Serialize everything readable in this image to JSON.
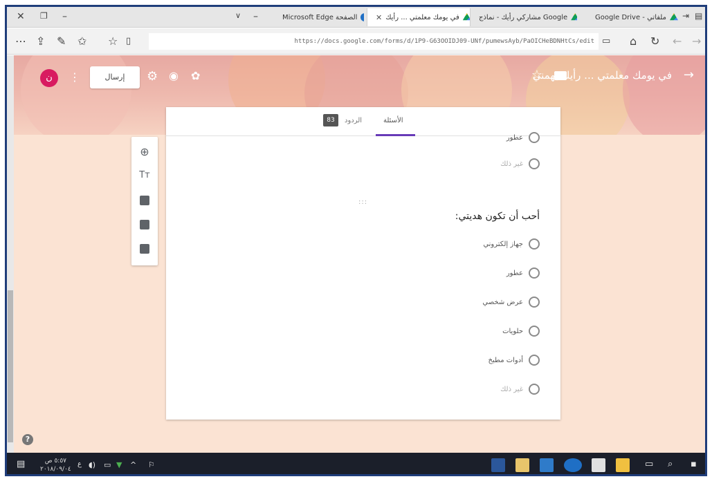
{
  "browser": {
    "tabs": [
      {
        "label": "Google Drive - ملفاتي",
        "icon": "drive-icon"
      },
      {
        "label": "مشاركي رأيك - نماذج Google",
        "icon": "drive-icon"
      },
      {
        "label": "في يومك معلمتي ... رأيك",
        "icon": "forms-icon",
        "active": true
      },
      {
        "label": "Microsoft Edge الصفحة",
        "icon": "edge-icon"
      }
    ],
    "url": "https://docs.google.com/forms/d/1P9-G63OOIDJ09-UNf/pumewsAyb/PaOICHeBDNHtCs/edit"
  },
  "header": {
    "title": "في يومك معلمتي ... رأيك يهمني",
    "send_label": "إرسال",
    "avatar_letter": "ن"
  },
  "card": {
    "tabs": {
      "questions": "الأسئلة",
      "responses": "الردود",
      "response_count": "83"
    },
    "prev_options": [
      "عطور",
      "غير ذلك"
    ],
    "question_title": "أحب أن تكون هديتي:",
    "options": [
      "جهاز إلكتروني",
      "عطور",
      "عرض شخصي",
      "حلويات",
      "أدوات مطبخ",
      "غير ذلك"
    ]
  },
  "taskbar": {
    "time": "٥:٥٧ ص",
    "date": "٢٠١٨/٠٩/٠٤",
    "lang": "ع"
  },
  "colors": {
    "accent": "#673ab7",
    "avatar": "#d81b60",
    "page_bg": "#fbe3d3",
    "taskbar": "#1b1f2a"
  }
}
